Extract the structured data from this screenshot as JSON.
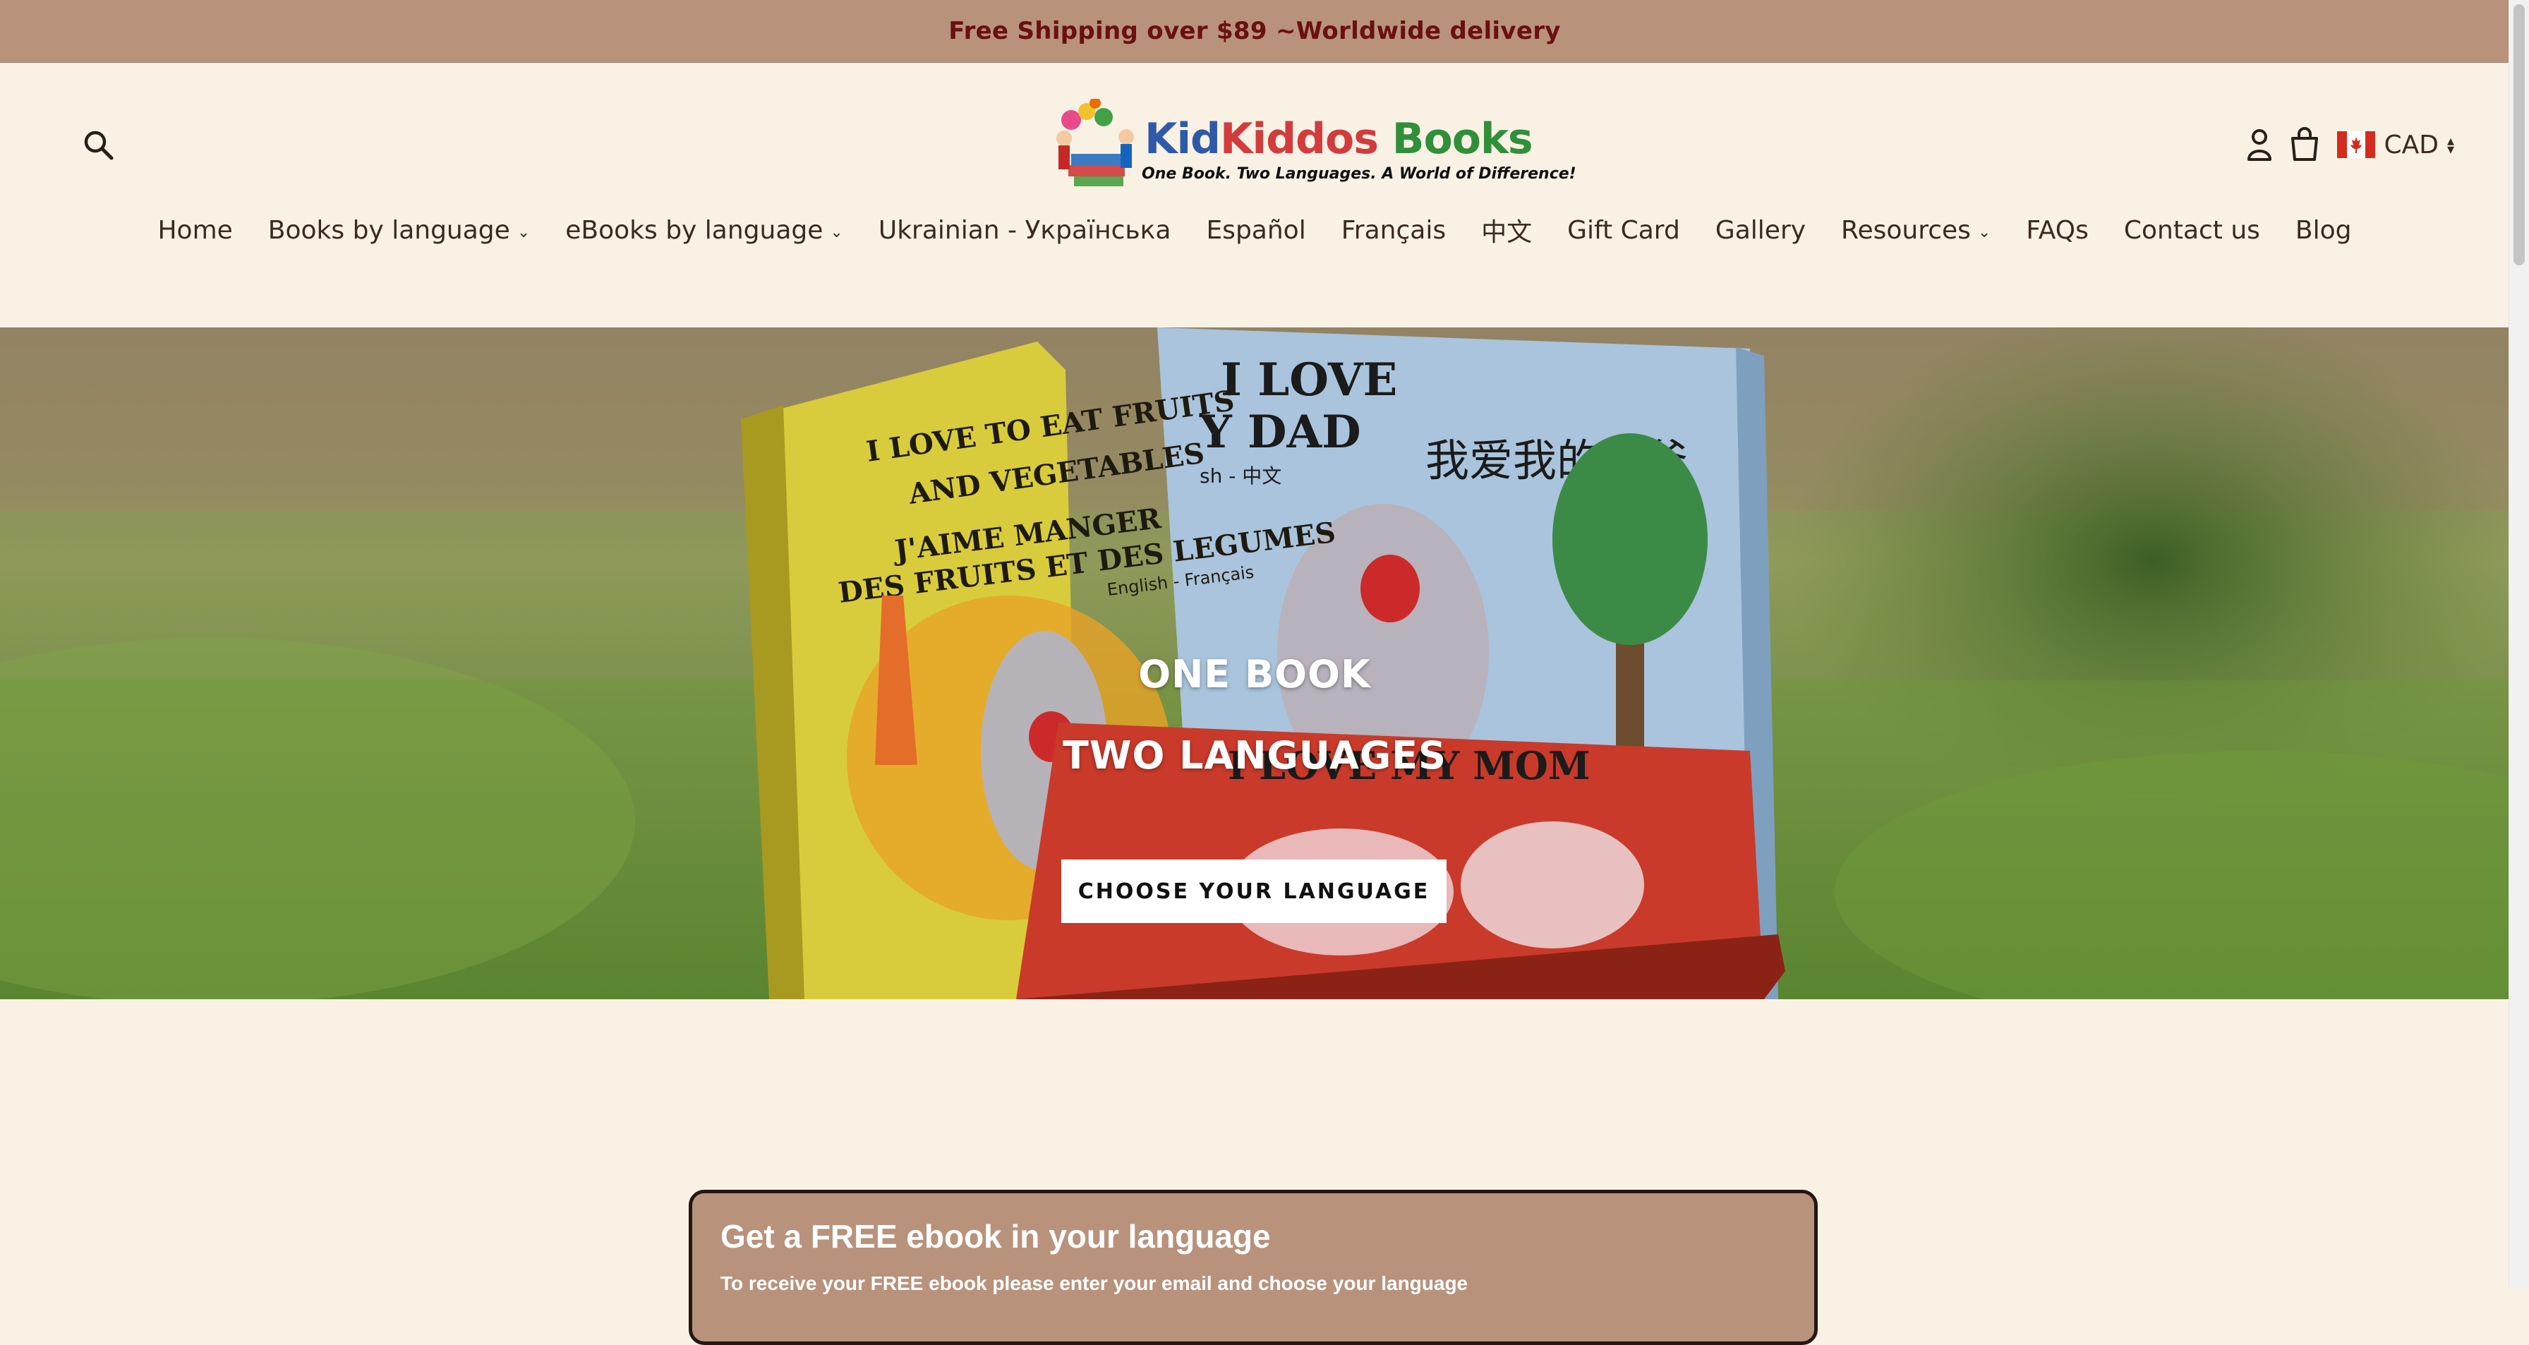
{
  "announcement": {
    "text": "Free Shipping over $89 ~Worldwide delivery"
  },
  "header": {
    "logo": {
      "brand_a": "Kid",
      "brand_b": "Kiddos",
      "brand_c": " Books",
      "tagline": "One Book. Two Languages. A World of Difference!"
    },
    "search_icon": "search-icon",
    "account_icon": "user-icon",
    "cart_icon": "cart-icon",
    "currency": {
      "code": "CAD",
      "flag": "canada-flag"
    }
  },
  "nav": {
    "items": [
      {
        "label": "Home",
        "has_dropdown": false
      },
      {
        "label": "Books by language",
        "has_dropdown": true
      },
      {
        "label": "eBooks by language",
        "has_dropdown": true
      },
      {
        "label": "Ukrainian - Українська",
        "has_dropdown": false
      },
      {
        "label": "Español",
        "has_dropdown": false
      },
      {
        "label": "Français",
        "has_dropdown": false
      },
      {
        "label": "中文",
        "has_dropdown": false
      },
      {
        "label": "Gift Card",
        "has_dropdown": false
      },
      {
        "label": "Gallery",
        "has_dropdown": false
      },
      {
        "label": "Resources",
        "has_dropdown": true
      },
      {
        "label": "FAQs",
        "has_dropdown": false
      },
      {
        "label": "Contact us",
        "has_dropdown": false
      },
      {
        "label": "Blog",
        "has_dropdown": false
      }
    ],
    "chevron": "⌄"
  },
  "hero": {
    "line1": "ONE BOOK",
    "line2": "TWO LANGUAGES",
    "cta": "CHOOSE YOUR LANGUAGE",
    "book_titles": {
      "yellow": "I LOVE TO EAT FRUITS AND VEGETABLES",
      "yellow_fr": "J'AIME MANGER DES FRUITS ET DES LEGUMES",
      "yellow_lang": "English - Français",
      "blue": "I LOVE MY DAD",
      "blue_zh": "我爱我的爸爸",
      "blue_lang": "sh - 中文",
      "red": "I LOVE MY MOM"
    }
  },
  "promo": {
    "title": "Get a FREE ebook in your language",
    "subtitle": "To receive your FREE ebook please enter your email and choose your language"
  },
  "colors": {
    "background": "#faf1e5",
    "announcement_bg": "#b9927c",
    "announcement_text": "#6a1010",
    "text": "#3a2a22",
    "promo_bg": "#b9927c"
  }
}
